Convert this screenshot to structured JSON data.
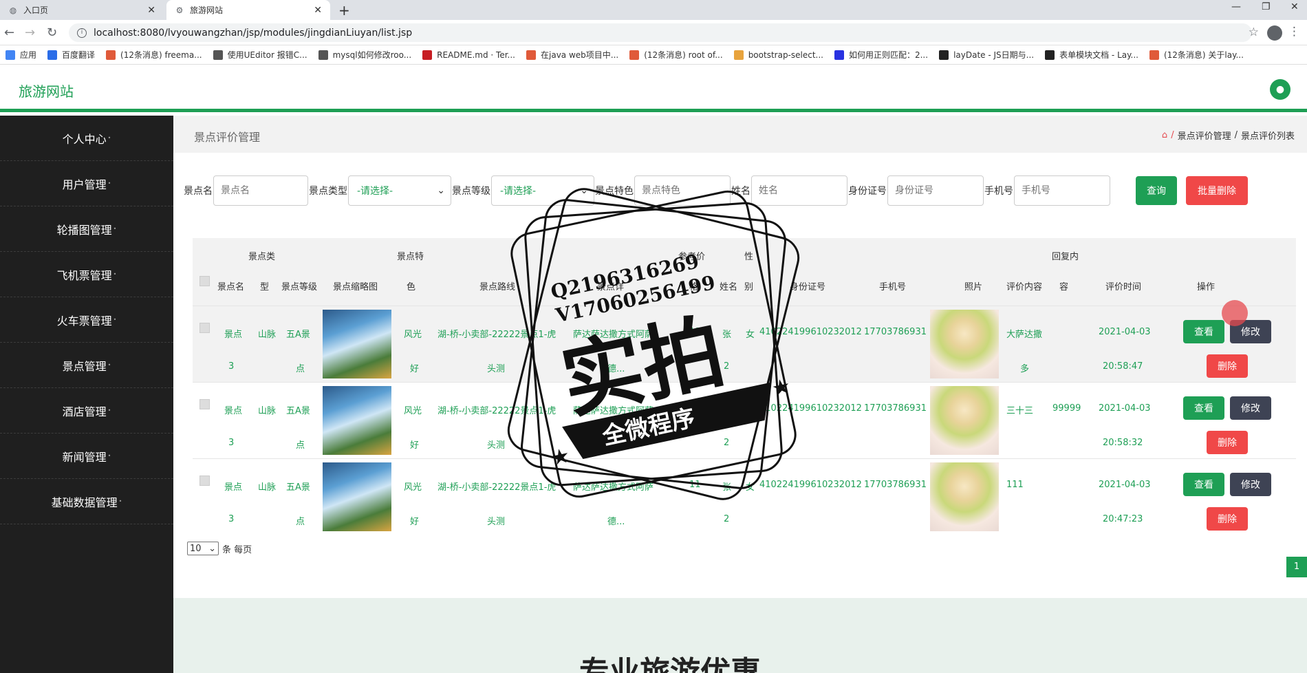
{
  "browser": {
    "tabs": [
      {
        "title": "入口页",
        "active": false
      },
      {
        "title": "旅游网站",
        "active": true
      }
    ],
    "url": "localhost:8080/lvyouwangzhan/jsp/modules/jingdianLiuyan/list.jsp",
    "bookmarks": [
      {
        "label": "应用",
        "color": "#4285f4"
      },
      {
        "label": "百度翻译",
        "color": "#2b6de8"
      },
      {
        "label": "(12条消息) freema...",
        "color": "#e05a3a"
      },
      {
        "label": "使用UEditor 报错C...",
        "color": "#555555"
      },
      {
        "label": "mysql如何修改roo...",
        "color": "#555555"
      },
      {
        "label": "README.md · Ter...",
        "color": "#c71d23"
      },
      {
        "label": "在java web项目中...",
        "color": "#e05a3a"
      },
      {
        "label": "(12条消息) root of...",
        "color": "#e05a3a"
      },
      {
        "label": "bootstrap-select...",
        "color": "#e8a33d"
      },
      {
        "label": "如何用正则匹配：2...",
        "color": "#2932e1"
      },
      {
        "label": "layDate - JS日期与...",
        "color": "#222222"
      },
      {
        "label": "表单模块文档 - Lay...",
        "color": "#222222"
      },
      {
        "label": "(12条消息) 关于lay...",
        "color": "#e05a3a"
      }
    ]
  },
  "app": {
    "brand": "旅游网站",
    "accent": "#1e9f55"
  },
  "sidebar": {
    "items": [
      "个人中心",
      "用户管理",
      "轮播图管理",
      "飞机票管理",
      "火车票管理",
      "景点管理",
      "酒店管理",
      "新闻管理",
      "基础数据管理"
    ]
  },
  "breadcrumb": {
    "title": "景点评价管理",
    "path": [
      "景点评价管理",
      "景点评价列表"
    ]
  },
  "filters": {
    "name_label": "景点名",
    "name_ph": "景点名",
    "type_label": "景点类型",
    "type_value": "-请选择-",
    "level_label": "景点等级",
    "level_value": "-请选择-",
    "feature_label": "景点特色",
    "feature_ph": "景点特色",
    "person_label": "姓名",
    "person_ph": "姓名",
    "id_label": "身份证号",
    "id_ph": "身份证号",
    "phone_label": "手机号",
    "phone_ph": "手机号",
    "search_btn": "查询",
    "batch_delete_btn": "批量删除"
  },
  "table": {
    "headers_top": {
      "type": "景点类",
      "feature": "景点特",
      "price": "参考价",
      "sex": "性",
      "reply": "回复内"
    },
    "headers": {
      "name": "景点名",
      "type": "型",
      "level": "景点等级",
      "thumb": "景点缩略图",
      "feature": "色",
      "route": "景点路线",
      "intro": "景点详",
      "price": "格",
      "person": "姓名",
      "sex": "别",
      "id": "身份证号",
      "phone": "手机号",
      "photo": "照片",
      "content": "评价内容",
      "reply": "容",
      "time": "评价时间",
      "ops": "操作"
    },
    "rows": [
      {
        "name1": "景点",
        "name2": "3",
        "type": "山脉",
        "level1": "五A景",
        "level2": "点",
        "feature1": "风光",
        "feature2": "好",
        "route1": "湖-桥-小卖部-22222景点1-虎",
        "route2": "头测",
        "intro1": "萨达萨达撒方式阿萨",
        "intro2": "德...",
        "price": "11",
        "person": "张",
        "person2": "2",
        "sex": "女",
        "id": "410224199610232012",
        "phone": "17703786931",
        "content1": "大萨达撒",
        "content2": "多",
        "reply": "",
        "time1": "2021-04-03",
        "time2": "20:58:47"
      },
      {
        "name1": "景点",
        "name2": "3",
        "type": "山脉",
        "level1": "五A景",
        "level2": "点",
        "feature1": "风光",
        "feature2": "好",
        "route1": "湖-桥-小卖部-22222景点1-虎",
        "route2": "头测",
        "intro1": "萨达萨达撒方式阿萨",
        "intro2": "德...",
        "price": "11",
        "person": "张",
        "person2": "2",
        "sex": "女",
        "id": "410224199610232012",
        "phone": "17703786931",
        "content1": "三十三",
        "content2": "",
        "reply": "99999",
        "time1": "2021-04-03",
        "time2": "20:58:32"
      },
      {
        "name1": "景点",
        "name2": "3",
        "type": "山脉",
        "level1": "五A景",
        "level2": "点",
        "feature1": "风光",
        "feature2": "好",
        "route1": "湖-桥-小卖部-22222景点1-虎",
        "route2": "头测",
        "intro1": "萨达萨达撒方式阿萨",
        "intro2": "德...",
        "price": "11",
        "person": "张",
        "person2": "2",
        "sex": "女",
        "id": "410224199610232012",
        "phone": "17703786931",
        "content1": "111",
        "content2": "",
        "reply": "",
        "time1": "2021-04-03",
        "time2": "20:47:23"
      }
    ],
    "btn_view": "查看",
    "btn_edit": "修改",
    "btn_delete": "删除"
  },
  "pager": {
    "page_size": "10",
    "per_page_label": "条 每页",
    "current_page": "1"
  },
  "footer": {
    "title": "专业旅游优惠"
  },
  "watermark": {
    "line1": "Q2196316269",
    "line2": "V17060256499",
    "main": "实拍",
    "ribbon": "全微程序"
  }
}
